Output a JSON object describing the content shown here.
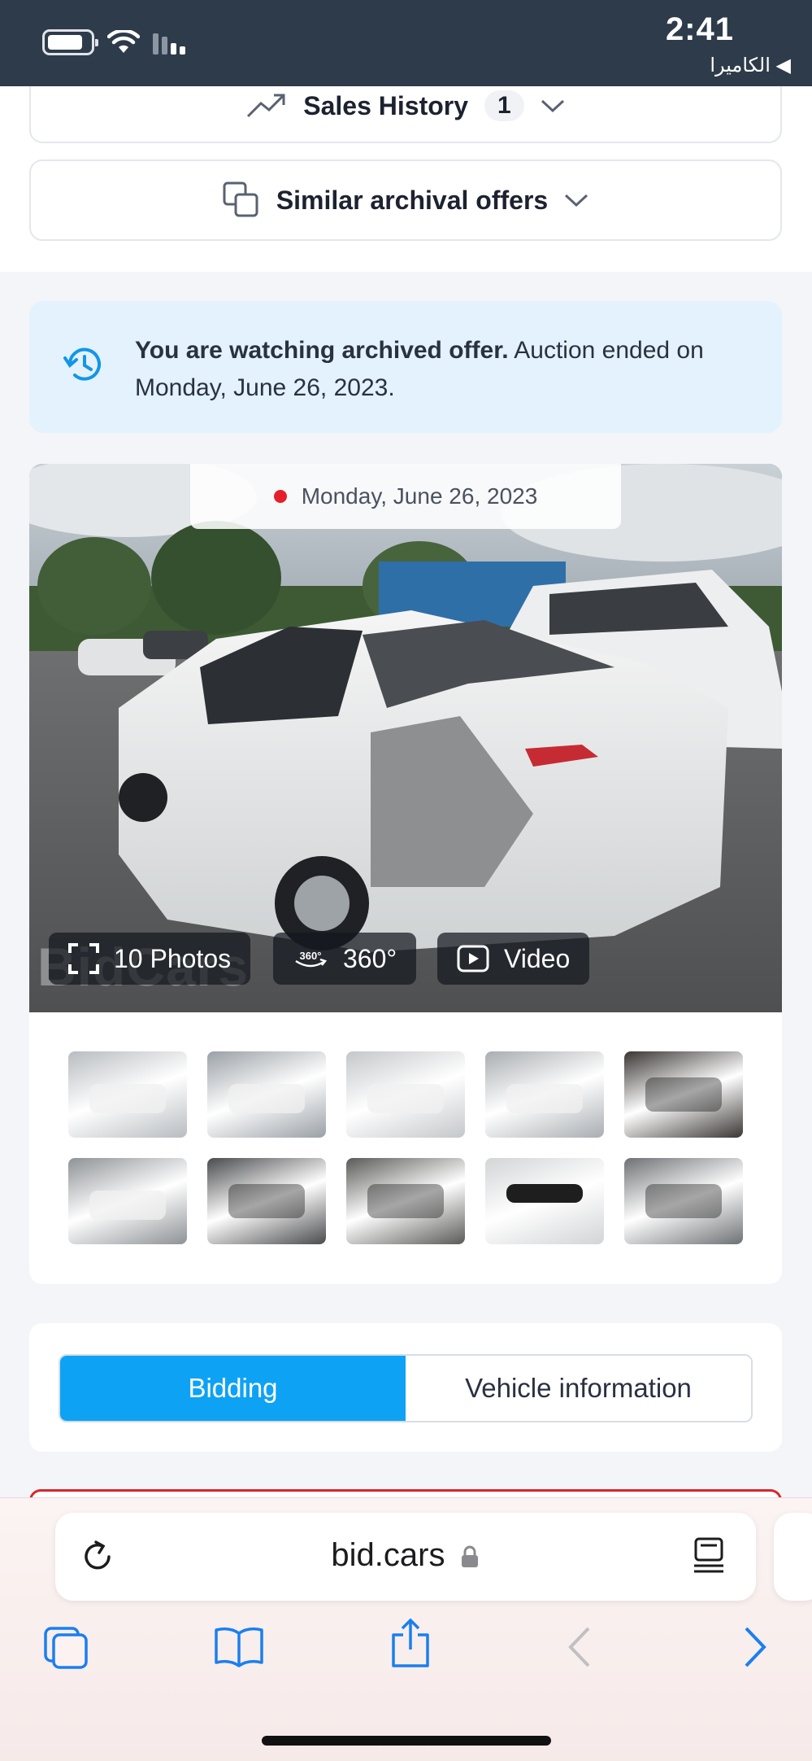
{
  "status_bar": {
    "time": "2:41",
    "back_app": "◀ الكاميرا"
  },
  "sales_history": {
    "label": "Sales History",
    "count": "1"
  },
  "similar_offers": {
    "label": "Similar archival offers"
  },
  "archived_notice": {
    "bold": "You are watching archived offer.",
    "rest": " Auction ended on Monday, June 26, 2023."
  },
  "gallery": {
    "date": "Monday, June 26, 2023",
    "photos_label": "10 Photos",
    "spin_label": "360°",
    "video_label": "Video",
    "watermark": "BidCars",
    "thumbnails": [
      {
        "name": "front-left",
        "bg": "#b8bcc0"
      },
      {
        "name": "front",
        "bg": "#9aa0a6"
      },
      {
        "name": "rear-right",
        "bg": "#c4c7ca"
      },
      {
        "name": "rear-left",
        "bg": "#a9adb1"
      },
      {
        "name": "interior-front",
        "bg": "#3a3634"
      },
      {
        "name": "rear",
        "bg": "#8e9296"
      },
      {
        "name": "dashboard",
        "bg": "#4a4b4d"
      },
      {
        "name": "interior-seat",
        "bg": "#5a5a58"
      },
      {
        "name": "vin-label",
        "bg": "#d2d4d6"
      },
      {
        "name": "engine",
        "bg": "#6e7174"
      }
    ]
  },
  "tabs": {
    "bidding": "Bidding",
    "vehicle_info": "Vehicle information"
  },
  "browser": {
    "url": "bid.cars"
  }
}
